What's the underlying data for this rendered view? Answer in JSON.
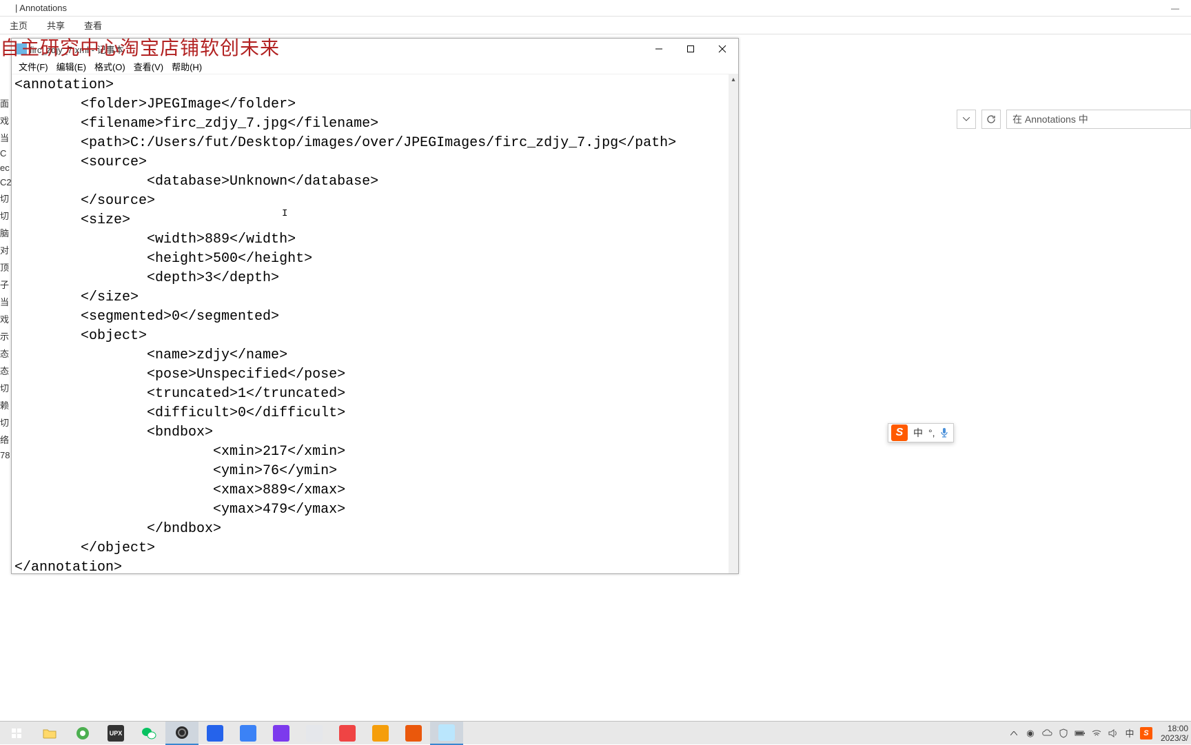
{
  "explorer": {
    "title": "Annotations",
    "tabs": [
      "主页",
      "共享",
      "查看"
    ],
    "search_prefix": "在 Annotations 中"
  },
  "watermark": "自主研究中心淘宝店铺软创未来",
  "notepad": {
    "title": "firc_zdjy_7.xml - 记事本",
    "menus": [
      "文件(F)",
      "编辑(E)",
      "格式(O)",
      "查看(V)",
      "帮助(H)"
    ],
    "content": "<annotation>\n\t<folder>JPEGImage</folder>\n\t<filename>firc_zdjy_7.jpg</filename>\n\t<path>C:/Users/fut/Desktop/images/over/JPEGImages/firc_zdjy_7.jpg</path>\n\t<source>\n\t\t<database>Unknown</database>\n\t</source>\n\t<size>\n\t\t<width>889</width>\n\t\t<height>500</height>\n\t\t<depth>3</depth>\n\t</size>\n\t<segmented>0</segmented>\n\t<object>\n\t\t<name>zdjy</name>\n\t\t<pose>Unspecified</pose>\n\t\t<truncated>1</truncated>\n\t\t<difficult>0</difficult>\n\t\t<bndbox>\n\t\t\t<xmin>217</xmin>\n\t\t\t<ymin>76</ymin>\n\t\t\t<xmax>889</xmax>\n\t\t\t<ymax>479</ymax>\n\t\t</bndbox>\n\t</object>\n</annotation>"
  },
  "left_icons": [
    "面",
    "戏",
    "当",
    "C",
    "ec",
    "C2",
    "切",
    "切",
    "脑",
    "对",
    "顶",
    "子",
    "当",
    "戏",
    "示",
    "态",
    "态",
    "切",
    "赖",
    "切",
    "络",
    "78"
  ],
  "ime": {
    "lang": "中",
    "punct": "°,",
    "mic": "🎤"
  },
  "taskbar": {
    "items": [
      {
        "name": "start",
        "bg": "#0078d7",
        "label": ""
      },
      {
        "name": "explorer",
        "bg": "#ffe27a",
        "label": ""
      },
      {
        "name": "browser",
        "bg": "#4caf50",
        "label": ""
      },
      {
        "name": "upx",
        "bg": "#333",
        "label": "UPX"
      },
      {
        "name": "wechat",
        "bg": "#fff",
        "label": ""
      },
      {
        "name": "obs",
        "bg": "#2b2b2b",
        "label": "",
        "active": true
      },
      {
        "name": "app-blue1",
        "bg": "#2563eb",
        "label": ""
      },
      {
        "name": "app-blue2",
        "bg": "#3b82f6",
        "label": ""
      },
      {
        "name": "app-purple",
        "bg": "#7c3aed",
        "label": ""
      },
      {
        "name": "app-paper",
        "bg": "#e5e7eb",
        "label": ""
      },
      {
        "name": "app-red",
        "bg": "#ef4444",
        "label": ""
      },
      {
        "name": "potplayer",
        "bg": "#f59e0b",
        "label": ""
      },
      {
        "name": "app-orange",
        "bg": "#ea580c",
        "label": ""
      },
      {
        "name": "notepad-task",
        "bg": "#bae6fd",
        "label": "",
        "active": true
      }
    ],
    "tray_lang": "中",
    "tray_time": "18:00",
    "tray_date": "2023/3/"
  }
}
